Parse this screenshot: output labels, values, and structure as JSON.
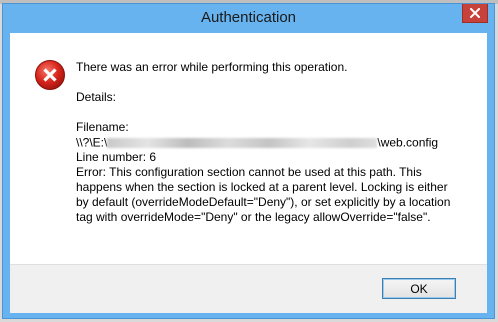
{
  "window": {
    "title": "Authentication",
    "close_icon": "close-icon"
  },
  "message": {
    "icon": "error-icon",
    "headline": "There was an error while performing this operation.",
    "details_label": "Details:",
    "filename_label": "Filename:",
    "filename_prefix": "\\\\?\\E:\\",
    "filename_suffix": "\\web.config",
    "line_number": "Line number: 6",
    "error_lines": [
      "Error: This configuration section cannot be used at this path. This",
      "happens when the section is locked at a parent level. Locking is either",
      "by default (overrideModeDefault=\"Deny\"), or set explicitly by a location",
      "tag with overrideMode=\"Deny\" or the legacy allowOverride=\"false\"."
    ]
  },
  "footer": {
    "ok_label": "OK"
  },
  "colors": {
    "title_bar": "#66b3f0",
    "close_button": "#c7423b",
    "error_icon": "#d9261c",
    "footer_bg": "#f0f0f0"
  }
}
